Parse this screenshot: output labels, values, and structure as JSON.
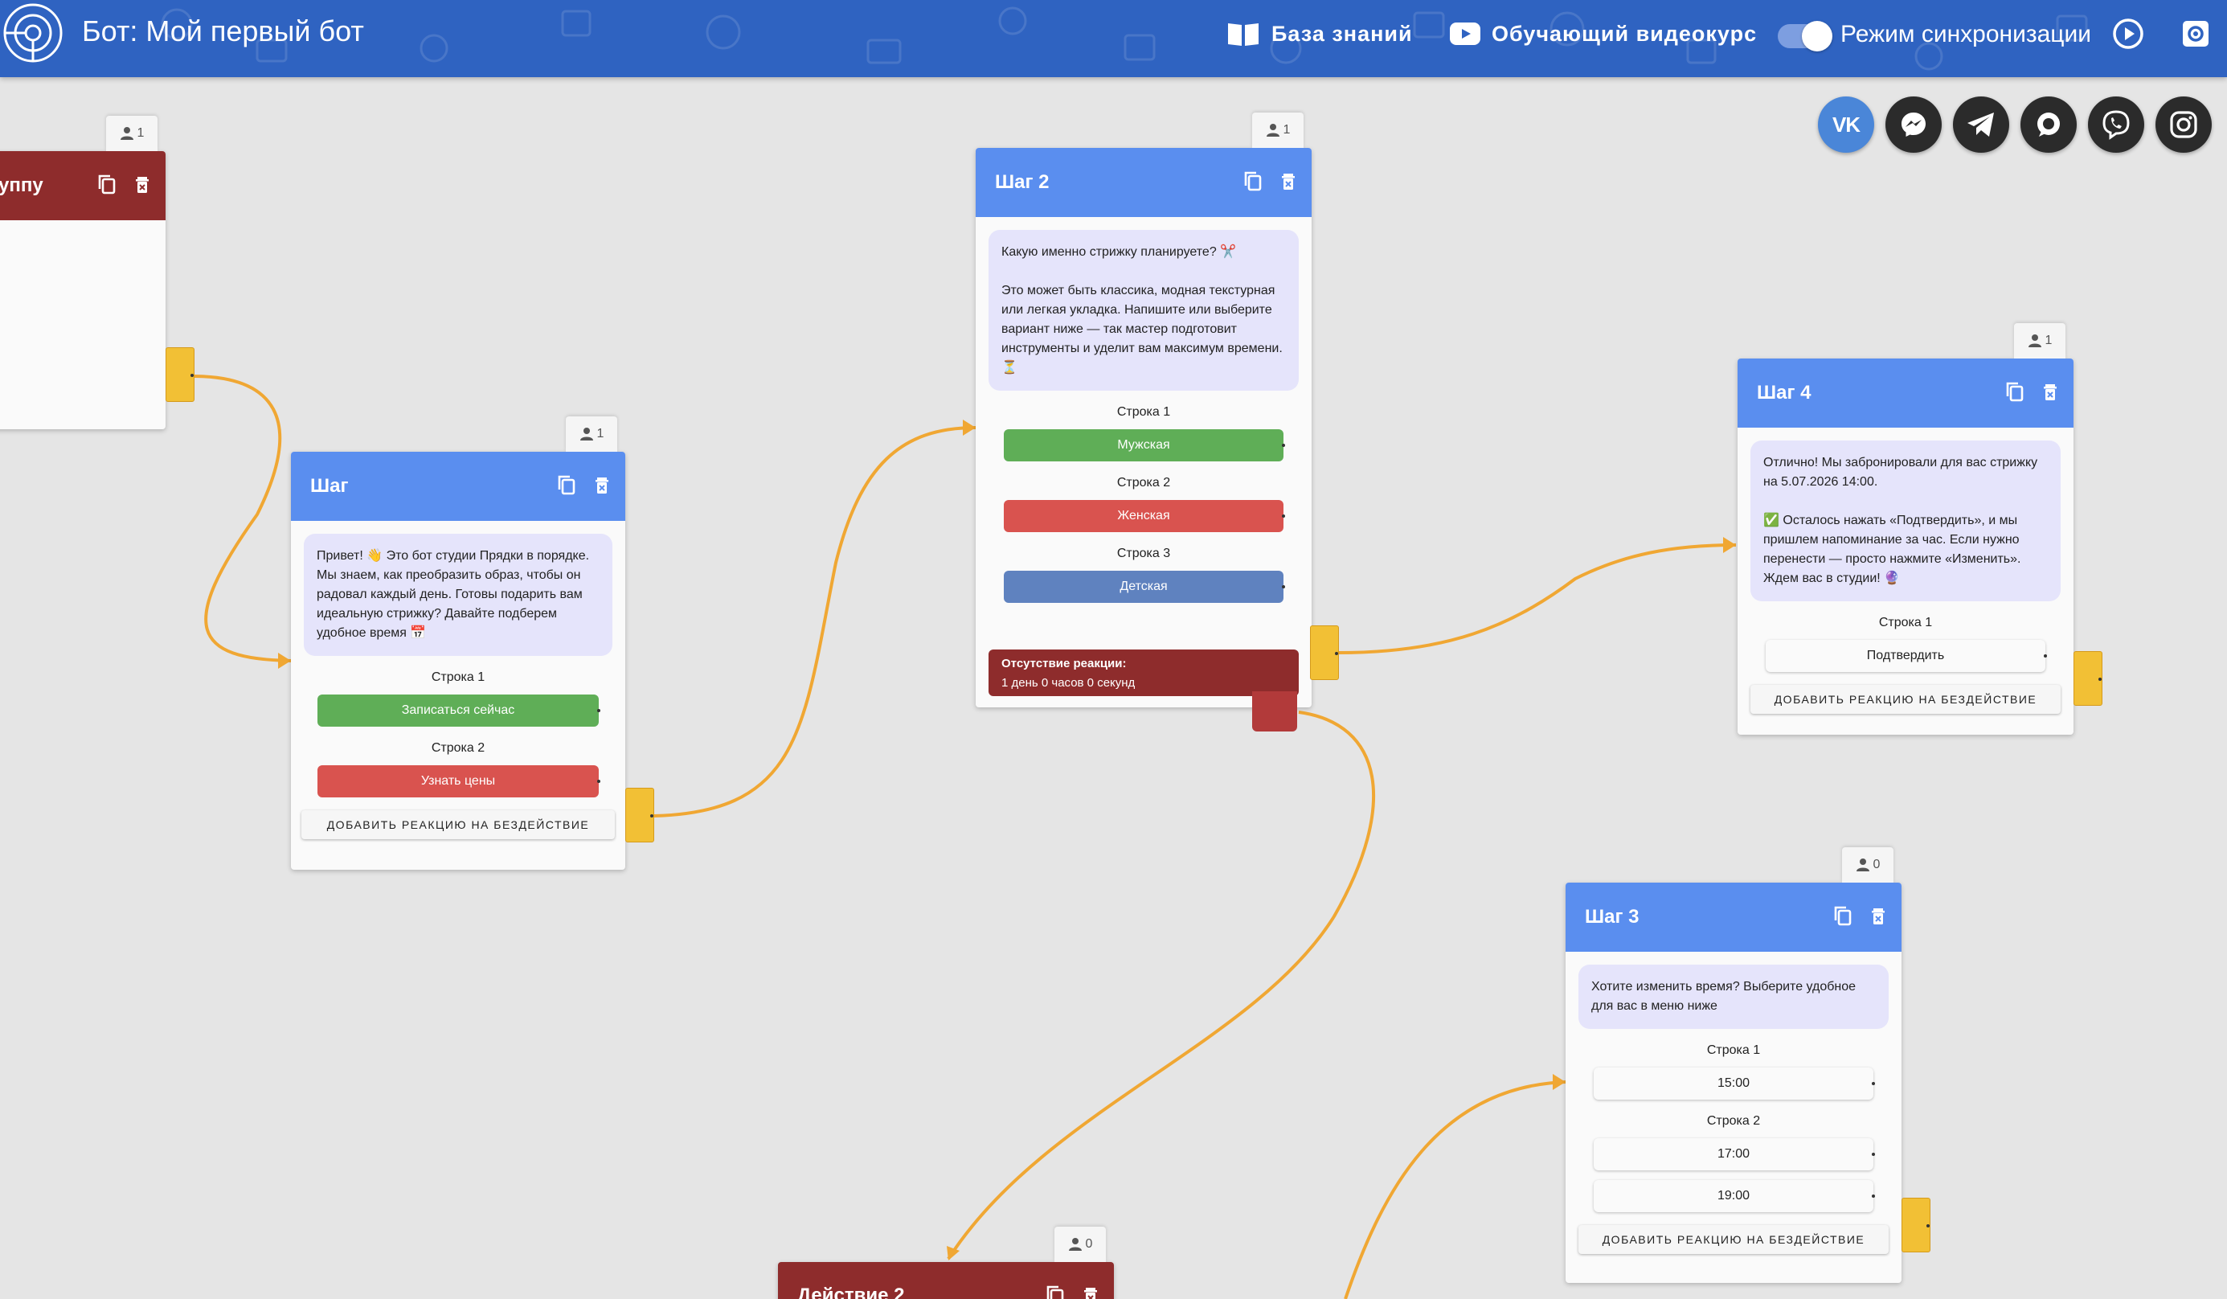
{
  "header": {
    "title": "Бот: Мой первый бот",
    "knowledge_base": "База знаний",
    "video_course": "Обучающий видеокурс",
    "sync_mode": "Режим синхронизации",
    "sync_enabled": true
  },
  "social": [
    "vk",
    "messenger",
    "telegram",
    "chat",
    "viber",
    "instagram"
  ],
  "cards": {
    "group": {
      "title": "уппу",
      "users": "1"
    },
    "step": {
      "title": "Шаг",
      "users": "1",
      "message": "Привет! 👋 Это бот студии Прядки в порядке. Мы знаем, как преобразить образ, чтобы он радовал каждый день. Готовы подарить вам идеальную стрижку? Давайте подберем удобное время 📅",
      "rows": [
        {
          "label": "Строка 1",
          "button": "Записаться сейчас"
        },
        {
          "label": "Строка 2",
          "button": "Узнать цены"
        }
      ],
      "add_reaction": "ДОБАВИТЬ РЕАКЦИЮ НА БЕЗДЕЙСТВИЕ"
    },
    "step2": {
      "title": "Шаг 2",
      "users": "1",
      "message": "Какую именно стрижку планируете? ✂️\n\nЭто может быть классика, модная текстурная или легкая укладка. Напишите или выберите вариант ниже — так мастер подготовит инструменты и уделит вам максимум времени. ⏳",
      "rows": [
        {
          "label": "Строка 1",
          "button": "Мужская"
        },
        {
          "label": "Строка 2",
          "button": "Женская"
        },
        {
          "label": "Строка 3",
          "button": "Детская"
        }
      ],
      "no_reaction_title": "Отсутствие реакции:",
      "no_reaction_value": "1 день 0 часов 0 секунд"
    },
    "step4": {
      "title": "Шаг 4",
      "users": "1",
      "message": "Отлично! Мы забронировали для вас стрижку на 5.07.2026 14:00.\n\n✅ Осталось нажать «Подтвердить», и мы пришлем напоминание за час. Если нужно перенести — просто нажмите «Изменить». Ждем вас в студии! 🔮",
      "rows": [
        {
          "label": "Строка 1",
          "button": "Подтвердить"
        }
      ],
      "add_reaction": "ДОБАВИТЬ РЕАКЦИЮ НА БЕЗДЕЙСТВИЕ"
    },
    "step3": {
      "title": "Шаг 3",
      "users": "0",
      "message": "Хотите изменить время? Выберите удобное для вас в меню ниже",
      "rows": [
        {
          "label": "Строка 1",
          "button": "15:00"
        },
        {
          "label": "Строка 2",
          "button": "17:00"
        }
      ],
      "extra_button": "19:00",
      "add_reaction": "ДОБАВИТЬ РЕАКЦИЮ НА БЕЗДЕЙСТВИЕ"
    },
    "action2": {
      "title": "Действие 2",
      "users": "0"
    }
  },
  "colors": {
    "header": "#2f63c1",
    "card_header": "#5a8eef",
    "dark_header": "#8e2c2c",
    "connector": "#f0a733",
    "port": "#f2c035",
    "green": "#5fae57",
    "red": "#d9534f",
    "blue": "#5f82bf"
  }
}
